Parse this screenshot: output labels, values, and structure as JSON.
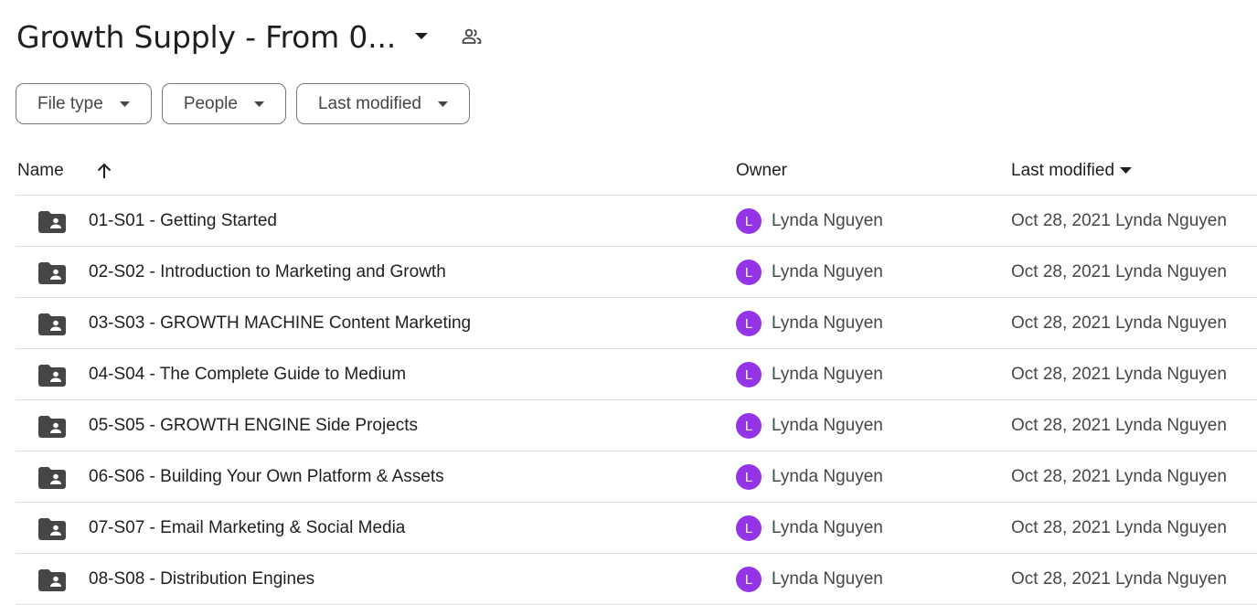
{
  "header": {
    "title": "Growth Supply - From 0...",
    "title_caret_icon": "arrow-drop-down-icon",
    "shared_icon": "people-icon"
  },
  "filters": [
    {
      "label": "File type"
    },
    {
      "label": "People"
    },
    {
      "label": "Last modified"
    }
  ],
  "table": {
    "columns": {
      "name": "Name",
      "owner": "Owner",
      "last_modified": "Last modified"
    },
    "sort_icon": "arrow-upward-icon",
    "rows": [
      {
        "name": "01-S01 - Getting Started",
        "owner_initial": "L",
        "owner": "Lynda Nguyen",
        "modified": "Oct 28, 2021 Lynda Nguyen"
      },
      {
        "name": "02-S02 - Introduction to Marketing and Growth",
        "owner_initial": "L",
        "owner": "Lynda Nguyen",
        "modified": "Oct 28, 2021 Lynda Nguyen"
      },
      {
        "name": "03-S03 - GROWTH MACHINE Content Marketing",
        "owner_initial": "L",
        "owner": "Lynda Nguyen",
        "modified": "Oct 28, 2021 Lynda Nguyen"
      },
      {
        "name": "04-S04 - The Complete Guide to Medium",
        "owner_initial": "L",
        "owner": "Lynda Nguyen",
        "modified": "Oct 28, 2021 Lynda Nguyen"
      },
      {
        "name": "05-S05 - GROWTH ENGINE Side Projects",
        "owner_initial": "L",
        "owner": "Lynda Nguyen",
        "modified": "Oct 28, 2021 Lynda Nguyen"
      },
      {
        "name": "06-S06 - Building Your Own Platform & Assets",
        "owner_initial": "L",
        "owner": "Lynda Nguyen",
        "modified": "Oct 28, 2021 Lynda Nguyen"
      },
      {
        "name": "07-S07 - Email Marketing & Social Media",
        "owner_initial": "L",
        "owner": "Lynda Nguyen",
        "modified": "Oct 28, 2021 Lynda Nguyen"
      },
      {
        "name": "08-S08 - Distribution Engines",
        "owner_initial": "L",
        "owner": "Lynda Nguyen",
        "modified": "Oct 28, 2021 Lynda Nguyen"
      }
    ]
  },
  "colors": {
    "avatar": "#9334e6",
    "icon": "#444746",
    "divider": "#dadce0"
  }
}
